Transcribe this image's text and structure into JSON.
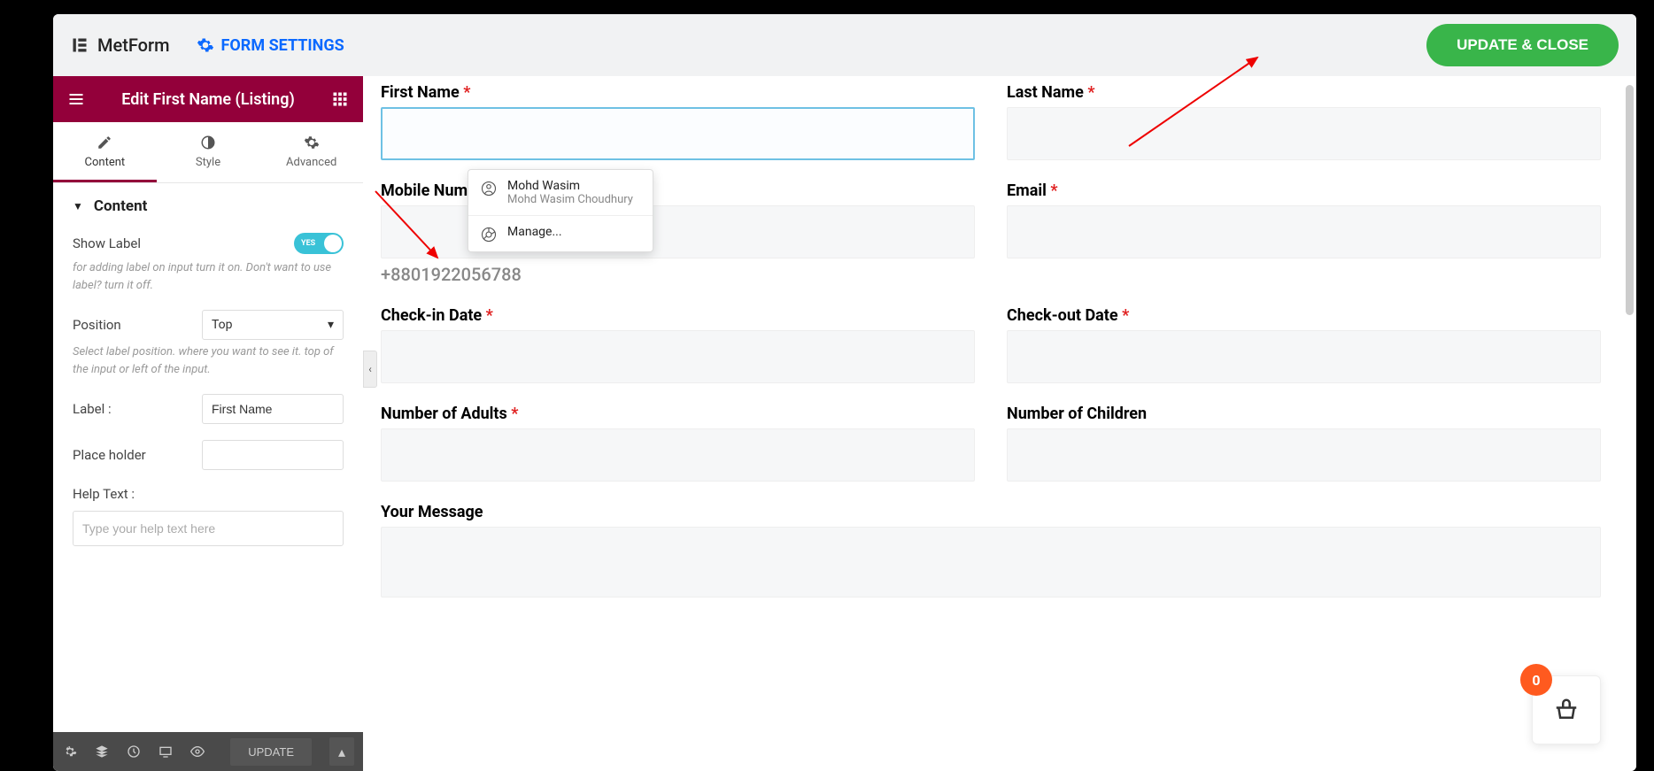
{
  "header": {
    "brand": "MetForm",
    "form_settings": "FORM SETTINGS",
    "update_close": "UPDATE & CLOSE"
  },
  "sidebar": {
    "title": "Edit First Name (Listing)",
    "tabs": {
      "content": "Content",
      "style": "Style",
      "advanced": "Advanced"
    },
    "section_title": "Content",
    "show_label": {
      "label": "Show Label",
      "value": "YES",
      "help": "for adding label on input turn it on. Don't want to use label? turn it off."
    },
    "position": {
      "label": "Position",
      "value": "Top",
      "help": "Select label position. where you want to see it. top of the input or left of the input."
    },
    "label_field": {
      "label": "Label :",
      "value": "First Name"
    },
    "placeholder_field": {
      "label": "Place holder",
      "value": ""
    },
    "help_text": {
      "label": "Help Text :",
      "placeholder": "Type your help text here"
    },
    "bottom": {
      "update": "UPDATE"
    }
  },
  "form": {
    "first_name": {
      "label": "First Name",
      "required": true
    },
    "last_name": {
      "label": "Last Name",
      "required": true
    },
    "mobile": {
      "label": "Mobile Number",
      "required": true,
      "hint": "+8801922056788"
    },
    "email": {
      "label": "Email",
      "required": true
    },
    "checkin": {
      "label": "Check-in Date",
      "required": true
    },
    "checkout": {
      "label": "Check-out Date",
      "required": true
    },
    "adults": {
      "label": "Number of Adults",
      "required": true
    },
    "children": {
      "label": "Number of Children",
      "required": false
    },
    "message": {
      "label": "Your Message",
      "required": false
    }
  },
  "autofill": {
    "name": "Mohd Wasim",
    "full": "Mohd Wasim Choudhury",
    "manage": "Manage..."
  },
  "cart": {
    "count": "0"
  }
}
